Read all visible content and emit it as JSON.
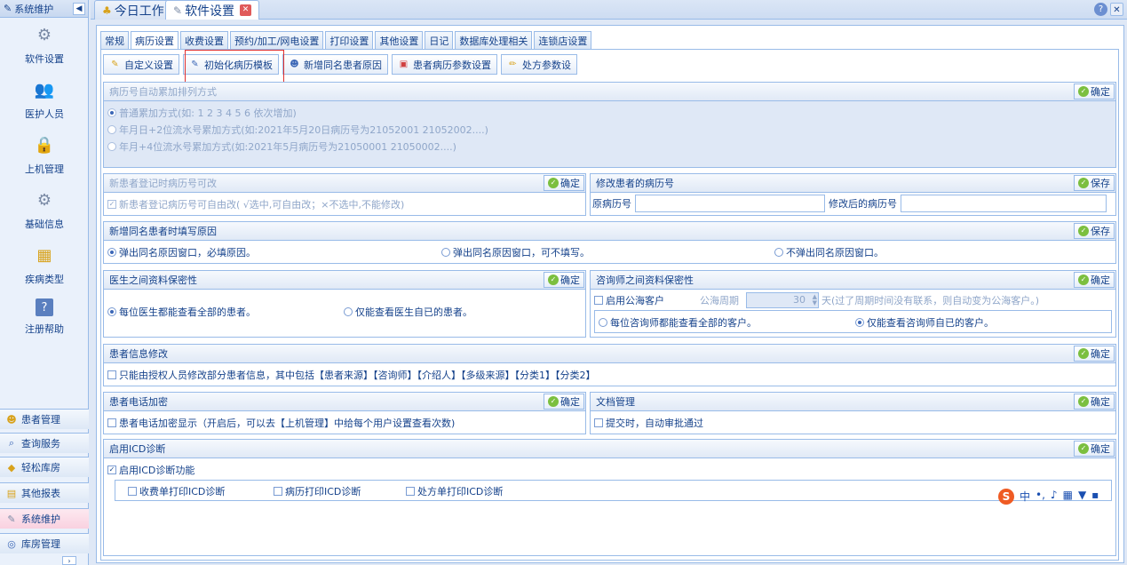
{
  "sidebar": {
    "header": "系统维护",
    "items": [
      {
        "label": "软件设置",
        "icon": "gear-icon"
      },
      {
        "label": "医护人员",
        "icon": "users-icon"
      },
      {
        "label": "上机管理",
        "icon": "lock-icon"
      },
      {
        "label": "基础信息",
        "icon": "gear-doc-icon"
      },
      {
        "label": "疾病类型",
        "icon": "tree-icon"
      },
      {
        "label": "注册帮助",
        "icon": "help-icon"
      }
    ],
    "accordion": [
      {
        "label": "患者管理",
        "icon": "people-icon"
      },
      {
        "label": "查询服务",
        "icon": "search-icon"
      },
      {
        "label": "轻松库房",
        "icon": "box-icon"
      },
      {
        "label": "其他报表",
        "icon": "report-icon"
      },
      {
        "label": "系统维护",
        "icon": "gear-icon"
      },
      {
        "label": "库房管理",
        "icon": "warehouse-icon"
      }
    ]
  },
  "top_tabs": [
    {
      "label": "今日工作"
    },
    {
      "label": "软件设置"
    }
  ],
  "sub_tabs": [
    "常规",
    "病历设置",
    "收费设置",
    "预约/加工/网电设置",
    "打印设置",
    "其他设置",
    "日记",
    "数据库处理相关",
    "连锁店设置"
  ],
  "toolbar": [
    "自定义设置",
    "初始化病历模板",
    "新增同名患者原因",
    "患者病历参数设置",
    "处方参数设"
  ],
  "common": {
    "ok": "确定",
    "save": "保存"
  },
  "p_number": {
    "title": "病历号自动累加排列方式",
    "options": [
      "普通累加方式(如: 1 2 3 4 5 6 依次增加)",
      "年月日+2位流水号累加方式(如:2021年5月20日病历号为21052001 21052002....)",
      "年月+4位流水号累加方式(如:2021年5月病历号为21050001 21050002....)"
    ]
  },
  "p_editable": {
    "title": "新患者登记时病历号可改",
    "option": "新患者登记病历号可自由改( √选中,可自由改；×不选中,不能修改)"
  },
  "p_modify": {
    "title": "修改患者的病历号",
    "orig_label": "原病历号",
    "new_label": "修改后的病历号"
  },
  "p_samename": {
    "title": "新增同名患者时填写原因",
    "options": [
      "弹出同名原因窗口，必填原因。",
      "弹出同名原因窗口，可不填写。",
      "不弹出同名原因窗口。"
    ]
  },
  "p_doctor": {
    "title": "医生之间资料保密性",
    "options": [
      "每位医生都能查看全部的患者。",
      "仅能查看医生自已的患者。"
    ]
  },
  "p_consult": {
    "title": "咨询师之间资料保密性",
    "enable": "启用公海客户",
    "period_label": "公海周期",
    "period_value": "30",
    "period_note": "天(过了周期时间没有联系，则自动变为公海客户。)",
    "options": [
      "每位咨询师都能查看全部的客户。",
      "仅能查看咨询师自已的客户。"
    ]
  },
  "p_info": {
    "title": "患者信息修改",
    "option": "只能由授权人员修改部分患者信息，其中包括【患者来源】【咨询师】【介绍人】【多级来源】【分类1】【分类2】"
  },
  "p_phone": {
    "title": "患者电话加密",
    "option": "患者电话加密显示（开启后，可以去【上机管理】中给每个用户设置查看次数)"
  },
  "p_doc": {
    "title": "文档管理",
    "option": "提交时，自动审批通过"
  },
  "p_icd": {
    "title": "启用ICD诊断",
    "option": "启用ICD诊断功能",
    "subs": [
      "收费单打印ICD诊断",
      "病历打印ICD诊断",
      "处方单打印ICD诊断"
    ]
  },
  "ime": {
    "logo": "S",
    "lang": "中"
  }
}
